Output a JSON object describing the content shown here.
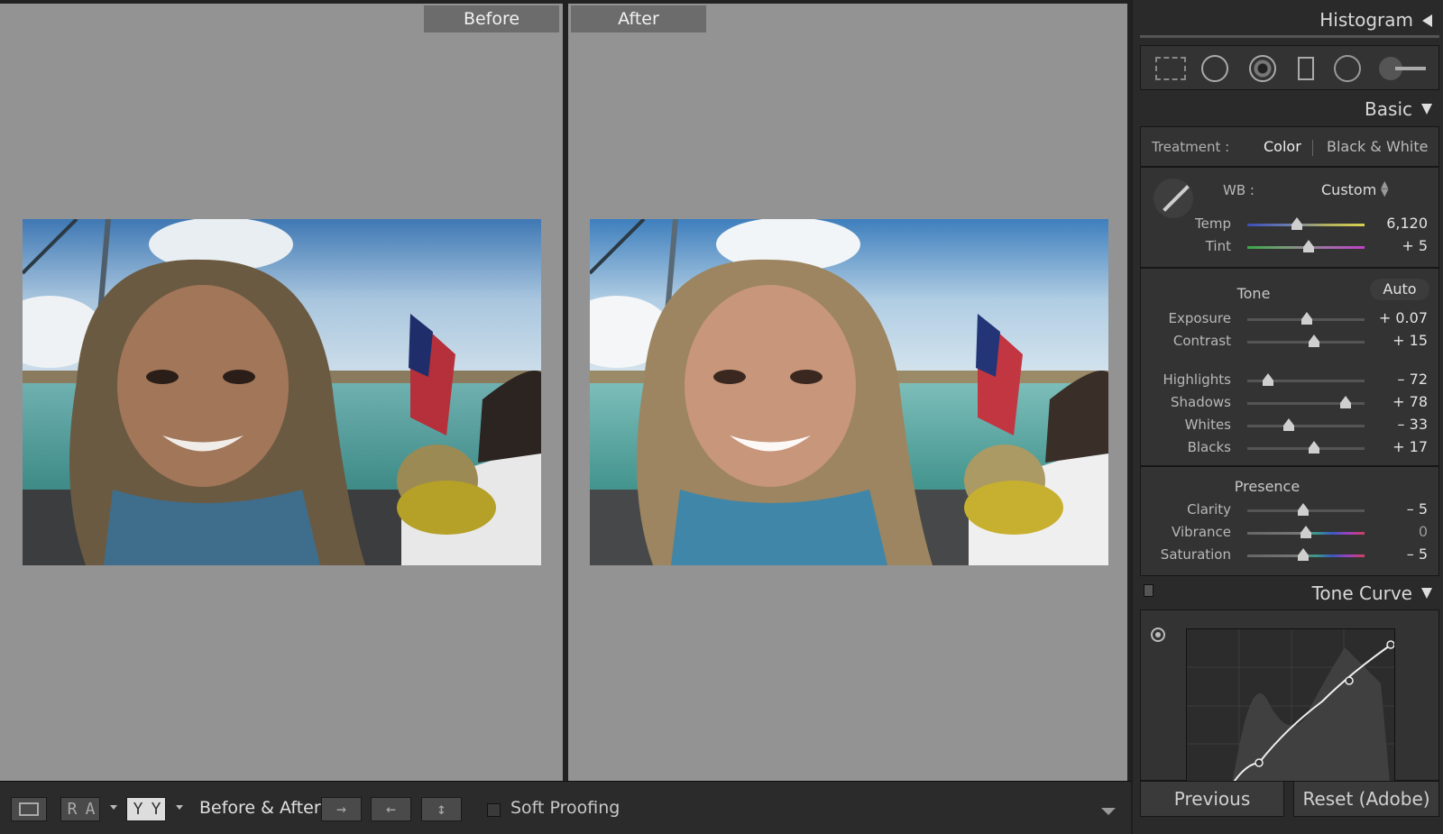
{
  "compare": {
    "before_label": "Before",
    "after_label": "After"
  },
  "toolbar": {
    "view_mode_icon": "loupe-view-icon",
    "ra_label_left": "R",
    "ra_label_right": "A",
    "yy_label_left": "Y",
    "yy_label_right": "Y",
    "before_after_label": "Before & After :",
    "copy_before_to_after_icon": "arrow-right-icon",
    "copy_after_to_before_icon": "arrow-left-icon",
    "swap_icon": "swap-vertical-icon",
    "soft_proofing_label": "Soft Proofing",
    "soft_proofing_checked": false
  },
  "panel": {
    "histogram_title": "Histogram",
    "tools": [
      "crop-overlay-icon",
      "spot-removal-icon",
      "red-eye-icon",
      "graduated-filter-icon",
      "radial-filter-icon",
      "adjustment-brush-icon"
    ],
    "basic_title": "Basic",
    "treatment_label": "Treatment :",
    "treatment_color": "Color",
    "treatment_bw": "Black & White",
    "wb_label": "WB :",
    "wb_value": "Custom",
    "temp_label": "Temp",
    "temp_value": "6,120",
    "temp_pos": 0.42,
    "tint_label": "Tint",
    "tint_value": "+ 5",
    "tint_pos": 0.52,
    "tone_label": "Tone",
    "auto_label": "Auto",
    "exposure_label": "Exposure",
    "exposure_value": "+ 0.07",
    "exposure_pos": 0.51,
    "contrast_label": "Contrast",
    "contrast_value": "+ 15",
    "contrast_pos": 0.57,
    "highlights_label": "Highlights",
    "highlights_value": "– 72",
    "highlights_pos": 0.18,
    "shadows_label": "Shadows",
    "shadows_value": "+ 78",
    "shadows_pos": 0.84,
    "whites_label": "Whites",
    "whites_value": "– 33",
    "whites_pos": 0.35,
    "blacks_label": "Blacks",
    "blacks_value": "+ 17",
    "blacks_pos": 0.57,
    "presence_label": "Presence",
    "clarity_label": "Clarity",
    "clarity_value": "– 5",
    "clarity_pos": 0.48,
    "vibrance_label": "Vibrance",
    "vibrance_value": "0",
    "vibrance_pos": 0.5,
    "saturation_label": "Saturation",
    "saturation_value": "– 5",
    "saturation_pos": 0.48,
    "tone_curve_title": "Tone Curve",
    "previous_label": "Previous",
    "reset_label": "Reset (Adobe)"
  }
}
